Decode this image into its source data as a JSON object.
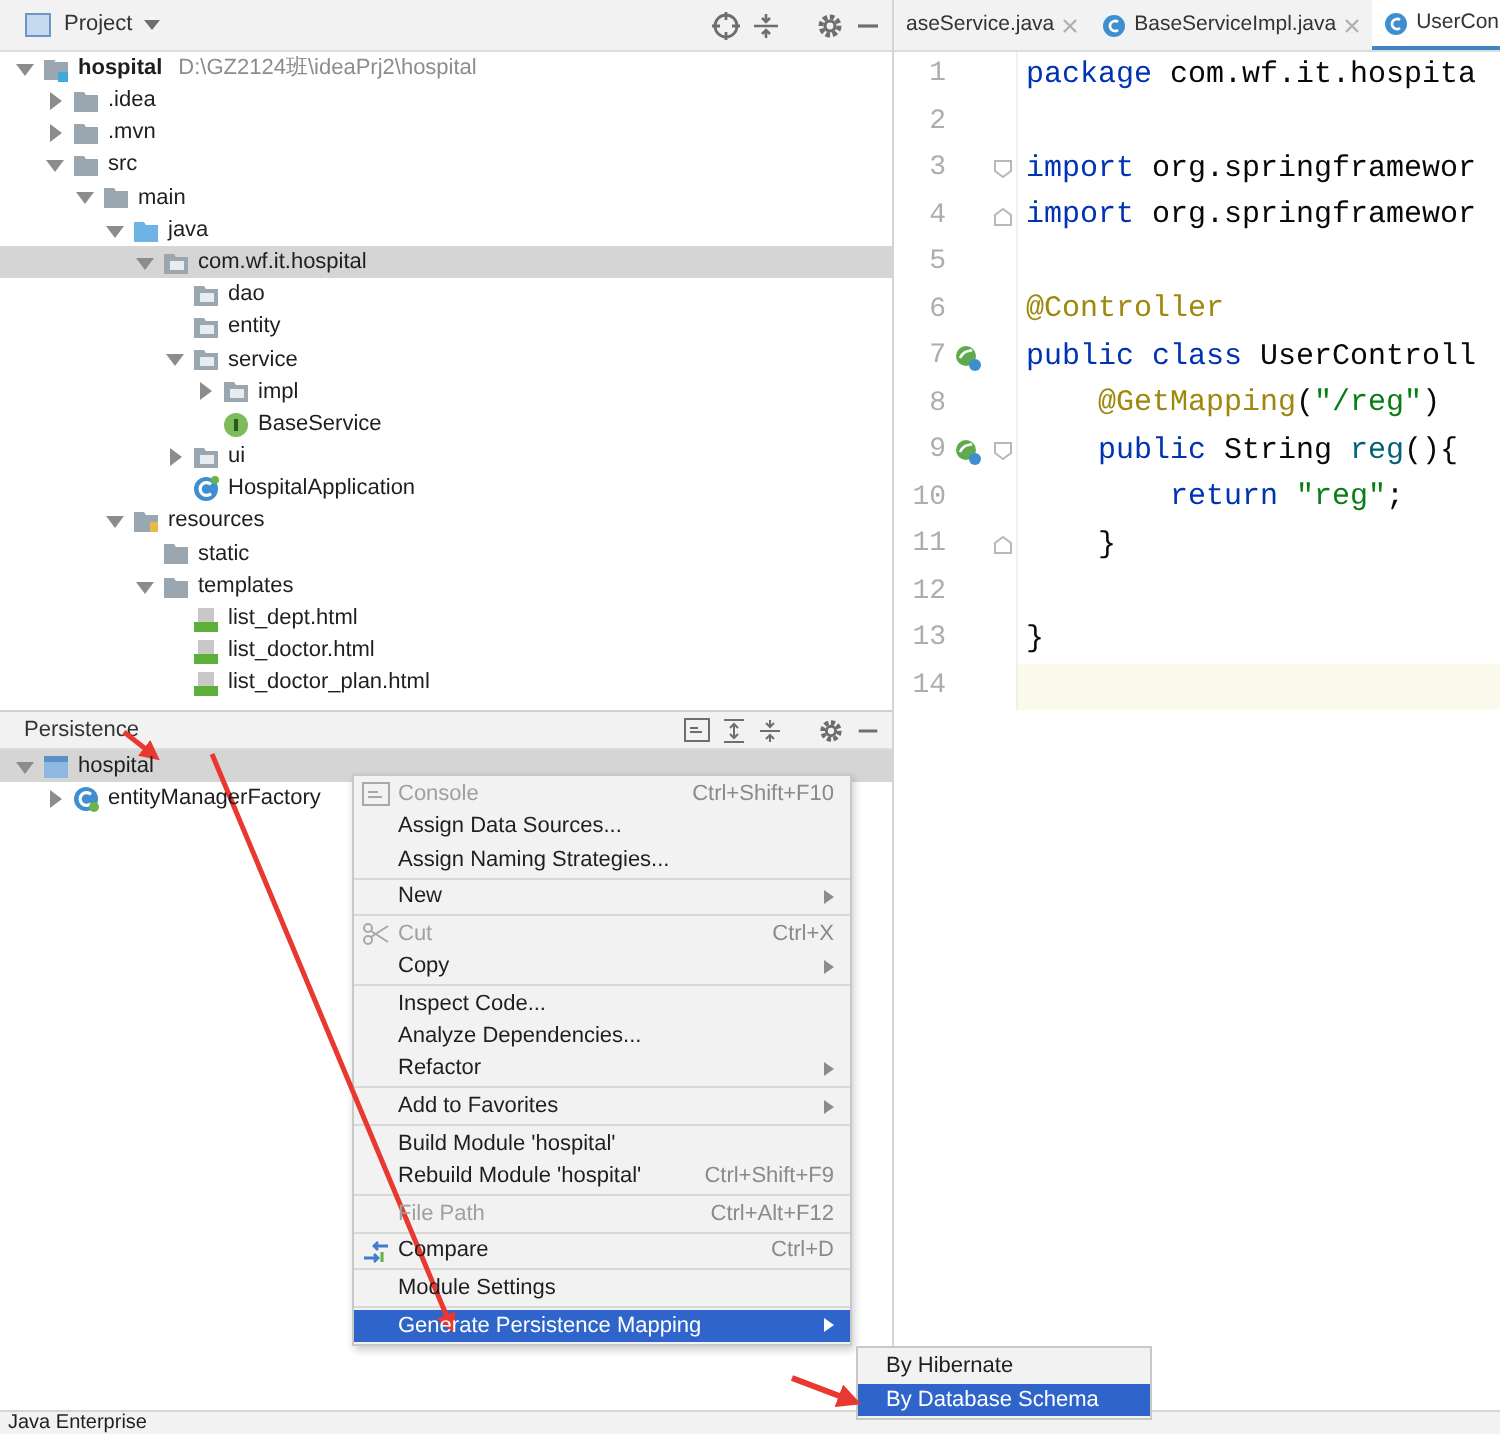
{
  "project_panel": {
    "title": "Project",
    "tree": [
      {
        "label": "hospital",
        "path": "D:\\GZ2124班\\ideaPrj2\\hospital",
        "kind": "module",
        "selected": false,
        "expanded": true,
        "children": [
          {
            "label": ".idea",
            "kind": "folder",
            "selected": false,
            "expanded": false
          },
          {
            "label": ".mvn",
            "kind": "folder",
            "selected": false,
            "expanded": false
          },
          {
            "label": "src",
            "kind": "folder",
            "selected": false,
            "expanded": true,
            "children": [
              {
                "label": "main",
                "kind": "folder",
                "selected": false,
                "expanded": true,
                "children": [
                  {
                    "label": "java",
                    "kind": "source",
                    "selected": false,
                    "expanded": true,
                    "children": [
                      {
                        "label": "com.wf.it.hospital",
                        "kind": "package",
                        "selected": true,
                        "expanded": true,
                        "children": [
                          {
                            "label": "dao",
                            "kind": "package",
                            "selected": false
                          },
                          {
                            "label": "entity",
                            "kind": "package",
                            "selected": false
                          },
                          {
                            "label": "service",
                            "kind": "package",
                            "selected": false,
                            "expanded": true,
                            "children": [
                              {
                                "label": "impl",
                                "kind": "package",
                                "selected": false,
                                "expanded": false
                              },
                              {
                                "label": "BaseService",
                                "kind": "interface",
                                "selected": false
                              }
                            ]
                          },
                          {
                            "label": "ui",
                            "kind": "package",
                            "selected": false,
                            "expanded": false
                          },
                          {
                            "label": "HospitalApplication",
                            "kind": "application",
                            "selected": false
                          }
                        ]
                      }
                    ]
                  },
                  {
                    "label": "resources",
                    "kind": "resources",
                    "selected": false,
                    "expanded": true,
                    "children": [
                      {
                        "label": "static",
                        "kind": "folder",
                        "selected": false
                      },
                      {
                        "label": "templates",
                        "kind": "folder",
                        "selected": false,
                        "expanded": true,
                        "children": [
                          {
                            "label": "list_dept.html",
                            "kind": "html",
                            "selected": false
                          },
                          {
                            "label": "list_doctor.html",
                            "kind": "html",
                            "selected": false
                          },
                          {
                            "label": "list_doctor_plan.html",
                            "kind": "html",
                            "selected": false
                          }
                        ]
                      }
                    ]
                  }
                ]
              }
            ]
          }
        ]
      }
    ]
  },
  "editor": {
    "tabs": [
      {
        "label": "aseService.java",
        "kind": "plain",
        "closable": true,
        "selected": false
      },
      {
        "label": "BaseServiceImpl.java",
        "kind": "class",
        "closable": true,
        "selected": false
      },
      {
        "label": "UserCon",
        "kind": "class",
        "closable": false,
        "selected": true
      }
    ],
    "lines": [
      {
        "number": "1",
        "current": false,
        "bean_marker": false,
        "fold_start": false,
        "fold_end": false,
        "tokens": [
          {
            "kind": "keyword",
            "text": "package"
          },
          {
            "kind": "plain",
            "text": " com.wf.it.hospita"
          }
        ]
      },
      {
        "number": "2",
        "current": false,
        "bean_marker": false,
        "fold_start": false,
        "fold_end": false
      },
      {
        "number": "3",
        "current": false,
        "bean_marker": false,
        "fold_start": true,
        "fold_end": false,
        "tokens": [
          {
            "kind": "keyword",
            "text": "import"
          },
          {
            "kind": "plain",
            "text": " org.springframewor"
          }
        ]
      },
      {
        "number": "4",
        "current": false,
        "bean_marker": false,
        "fold_start": false,
        "fold_end": true,
        "tokens": [
          {
            "kind": "keyword",
            "text": "import"
          },
          {
            "kind": "plain",
            "text": " org.springframewor"
          }
        ]
      },
      {
        "number": "5",
        "current": false,
        "bean_marker": false,
        "fold_start": false,
        "fold_end": false
      },
      {
        "number": "6",
        "current": false,
        "bean_marker": false,
        "fold_start": false,
        "fold_end": false,
        "tokens": [
          {
            "kind": "annotation",
            "text": "@Controller"
          }
        ]
      },
      {
        "number": "7",
        "current": false,
        "bean_marker": true,
        "fold_start": false,
        "fold_end": false,
        "tokens": [
          {
            "kind": "keyword",
            "text": "public class"
          },
          {
            "kind": "plain",
            "text": " UserControll"
          }
        ]
      },
      {
        "number": "8",
        "current": false,
        "bean_marker": false,
        "fold_start": false,
        "fold_end": false,
        "tokens": [
          {
            "kind": "annotation",
            "text": "    @GetMapping"
          },
          {
            "kind": "plain",
            "text": "("
          },
          {
            "kind": "string",
            "text": "\"/reg\""
          },
          {
            "kind": "plain",
            "text": ")"
          }
        ]
      },
      {
        "number": "9",
        "current": false,
        "bean_marker": true,
        "fold_start": true,
        "fold_end": false,
        "tokens": [
          {
            "kind": "keyword",
            "text": "    public"
          },
          {
            "kind": "plain",
            "text": " String "
          },
          {
            "kind": "method",
            "text": "reg"
          },
          {
            "kind": "plain",
            "text": "(){"
          }
        ]
      },
      {
        "number": "10",
        "current": false,
        "bean_marker": false,
        "fold_start": false,
        "fold_end": false,
        "tokens": [
          {
            "kind": "keyword",
            "text": "        return "
          },
          {
            "kind": "string",
            "text": "\"reg\""
          },
          {
            "kind": "plain",
            "text": ";"
          }
        ]
      },
      {
        "number": "11",
        "current": false,
        "bean_marker": false,
        "fold_start": false,
        "fold_end": true,
        "tokens": [
          {
            "kind": "plain",
            "text": "    }"
          }
        ]
      },
      {
        "number": "12",
        "current": false,
        "bean_marker": false,
        "fold_start": false,
        "fold_end": false
      },
      {
        "number": "13",
        "current": false,
        "bean_marker": false,
        "fold_start": false,
        "fold_end": false,
        "tokens": [
          {
            "kind": "plain",
            "text": "}"
          }
        ]
      },
      {
        "number": "14",
        "current": true,
        "bean_marker": false,
        "fold_start": false,
        "fold_end": false
      }
    ]
  },
  "persistence_panel": {
    "title": "Persistence",
    "tree": [
      {
        "label": "hospital",
        "kind": "unit",
        "selected": true,
        "expanded": true,
        "children": [
          {
            "label": "entityManagerFactory",
            "kind": "bean",
            "selected": false,
            "expanded": false
          }
        ]
      }
    ]
  },
  "context_menu": {
    "groups": [
      [
        {
          "label": "Console",
          "shortcut": "Ctrl+Shift+F10",
          "kind": "console",
          "disabled": true,
          "submenu": false,
          "selected": false
        },
        {
          "label": "Assign Data Sources...",
          "kind": "plain",
          "disabled": false,
          "submenu": false,
          "selected": false
        },
        {
          "label": "Assign Naming Strategies...",
          "kind": "plain",
          "disabled": false,
          "submenu": false,
          "selected": false
        }
      ],
      [
        {
          "label": "New",
          "kind": "plain",
          "disabled": false,
          "submenu": true,
          "selected": false
        }
      ],
      [
        {
          "label": "Cut",
          "shortcut": "Ctrl+X",
          "kind": "cut",
          "disabled": true,
          "submenu": false,
          "selected": false
        },
        {
          "label": "Copy",
          "kind": "plain",
          "disabled": false,
          "submenu": true,
          "selected": false
        }
      ],
      [
        {
          "label": "Inspect Code...",
          "kind": "plain",
          "disabled": false,
          "submenu": false,
          "selected": false
        },
        {
          "label": "Analyze Dependencies...",
          "kind": "plain",
          "disabled": false,
          "submenu": false,
          "selected": false
        },
        {
          "label": "Refactor",
          "kind": "plain",
          "disabled": false,
          "submenu": true,
          "selected": false
        }
      ],
      [
        {
          "label": "Add to Favorites",
          "kind": "plain",
          "disabled": false,
          "submenu": true,
          "selected": false
        }
      ],
      [
        {
          "label": "Build Module 'hospital'",
          "kind": "plain",
          "disabled": false,
          "submenu": false,
          "selected": false
        },
        {
          "label": "Rebuild Module 'hospital'",
          "shortcut": "Ctrl+Shift+F9",
          "kind": "plain",
          "disabled": false,
          "submenu": false,
          "selected": false
        }
      ],
      [
        {
          "label": "File Path",
          "shortcut": "Ctrl+Alt+F12",
          "kind": "plain",
          "disabled": true,
          "submenu": false,
          "selected": false
        }
      ],
      [
        {
          "label": "Compare",
          "shortcut": "Ctrl+D",
          "kind": "compare",
          "disabled": false,
          "submenu": false,
          "selected": false
        }
      ],
      [
        {
          "label": "Module Settings",
          "kind": "plain",
          "disabled": false,
          "submenu": false,
          "selected": false
        }
      ],
      [
        {
          "label": "Generate Persistence Mapping",
          "kind": "plain",
          "disabled": false,
          "submenu": true,
          "selected": true
        }
      ]
    ]
  },
  "submenu": {
    "items": [
      {
        "label": "By Hibernate",
        "selected": false
      },
      {
        "label": "By Database Schema",
        "selected": true
      }
    ]
  },
  "status_bar": {
    "label": "Java Enterprise"
  }
}
